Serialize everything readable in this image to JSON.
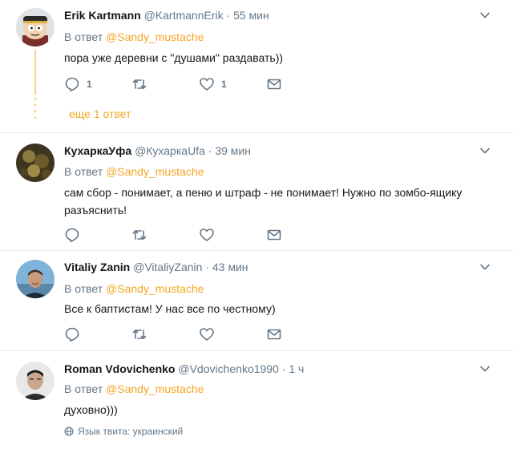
{
  "tweets": [
    {
      "name": "Erik Kartmann",
      "handle": "@KartmannErik",
      "dot": "·",
      "time": "55 мин",
      "reply_prefix": "В ответ",
      "reply_to": "@Sandy_mustache",
      "text": "пора уже деревни с \"душами\" раздавать))",
      "reply_count": "1",
      "retweet_count": "",
      "like_count": "1"
    },
    {
      "name": "КухаркаУфа",
      "handle": "@КухаркаUfa",
      "dot": "·",
      "time": "39 мин",
      "reply_prefix": "В ответ",
      "reply_to": "@Sandy_mustache",
      "text": "сам сбор - понимает, а пеню и штраф - не понимает! Нужно по зомбо-ящику разъяснить!",
      "reply_count": "",
      "retweet_count": "",
      "like_count": ""
    },
    {
      "name": "Vitaliy Zanin",
      "handle": "@VitaliyZanin",
      "dot": "·",
      "time": "43 мин",
      "reply_prefix": "В ответ",
      "reply_to": "@Sandy_mustache",
      "text": "Все к баптистам! У нас все по честному)",
      "reply_count": "",
      "retweet_count": "",
      "like_count": ""
    },
    {
      "name": "Roman Vdovichenko",
      "handle": "@Vdovichenko1990",
      "dot": "·",
      "time": "1 ч",
      "reply_prefix": "В ответ",
      "reply_to": "@Sandy_mustache",
      "text": "духовно)))",
      "language_note": "Язык твита: украинский"
    }
  ],
  "thread": {
    "more_replies": "еще 1 ответ"
  },
  "colors": {
    "accent": "#f5a623",
    "muted": "#657786",
    "thread_line": "#f5d58a",
    "divider": "#e6ecf0"
  },
  "icons": [
    "reply-icon",
    "retweet-icon",
    "like-icon",
    "message-icon",
    "chevron-down-icon",
    "globe-icon"
  ]
}
